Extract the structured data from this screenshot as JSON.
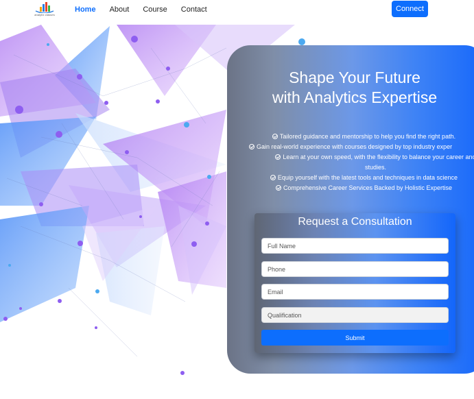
{
  "brand": {
    "logo_text": "analytix classes"
  },
  "nav": {
    "links": [
      "Home",
      "About",
      "Course",
      "Contact"
    ],
    "connect_label": "Connect"
  },
  "hero": {
    "title_line1": "Shape Your Future",
    "title_line2": "with Analytics Expertise",
    "features": [
      "Tailored guidance and mentorship to help you find the right path.",
      "Gain real-world experience with courses designed by top industry exper",
      "Learn at your own speed, with the flexibility to balance your career and studies.",
      "Equip yourself with the latest tools and techniques in data science",
      "Comprehensive Career Services Backed by Holistic Expertise"
    ]
  },
  "form": {
    "title": "Request a Consultation",
    "full_name_placeholder": "Full Name",
    "phone_placeholder": "Phone",
    "email_placeholder": "Email",
    "qualification_placeholder": "Qualification",
    "submit_label": "Submit"
  },
  "colors": {
    "primary": "#0d6efd",
    "art_purple": "#9b5de5",
    "art_blue": "#4a8cf7"
  }
}
